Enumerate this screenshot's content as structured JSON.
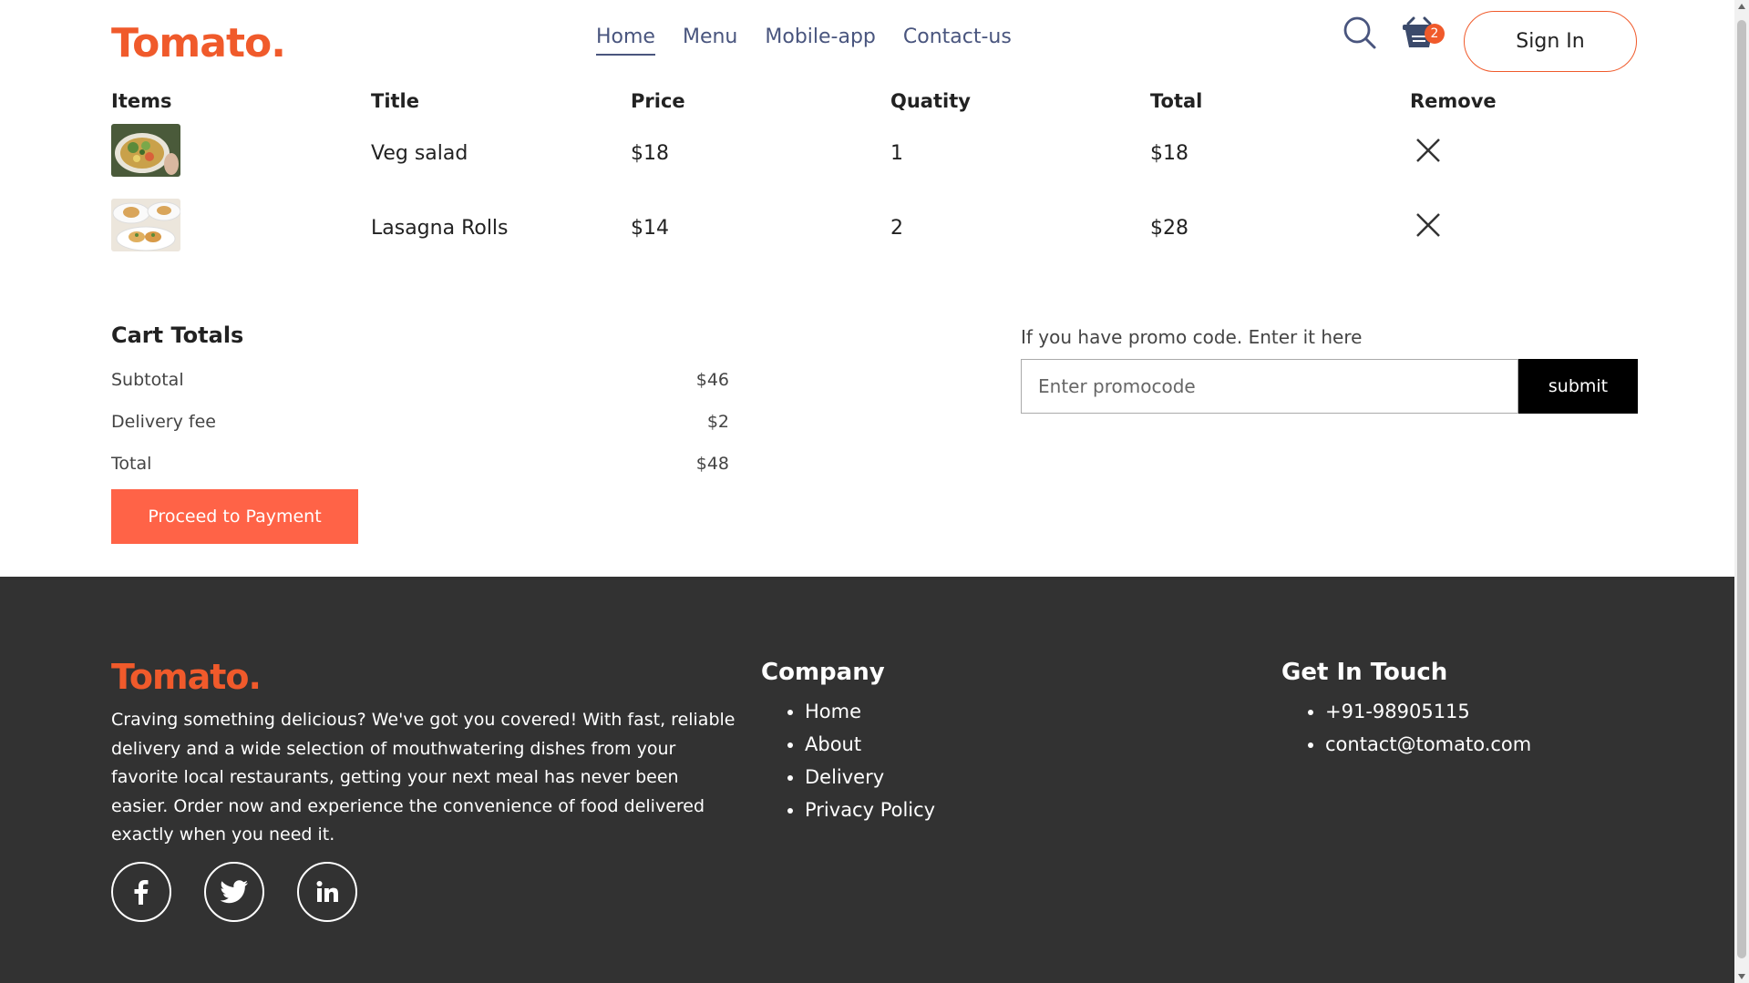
{
  "navbar": {
    "logo": "Tomato.",
    "links": [
      {
        "label": "Home",
        "active": true
      },
      {
        "label": "Menu",
        "active": false
      },
      {
        "label": "Mobile-app",
        "active": false
      },
      {
        "label": "Contact-us",
        "active": false
      }
    ],
    "search_icon": "search-icon",
    "cart_icon": "basket-icon",
    "cart_count": "2",
    "signin_label": "Sign In"
  },
  "cart": {
    "headers": [
      "Items",
      "Title",
      "Price",
      "Quatity",
      "Total",
      "Remove"
    ],
    "rows": [
      {
        "image": "veg-salad-thumbnail",
        "title": "Veg salad",
        "price": "$18",
        "quantity": "1",
        "total": "$18",
        "remove_icon": "close-icon"
      },
      {
        "image": "lasagna-rolls-thumbnail",
        "title": "Lasagna Rolls",
        "price": "$14",
        "quantity": "2",
        "total": "$28",
        "remove_icon": "close-icon"
      }
    ]
  },
  "totals": {
    "heading": "Cart Totals",
    "lines": [
      {
        "label": "Subtotal",
        "value": "$46"
      },
      {
        "label": "Delivery fee",
        "value": "$2"
      },
      {
        "label": "Total",
        "value": "$48"
      }
    ],
    "proceed_label": "Proceed to Payment"
  },
  "promo": {
    "label": "If you have promo code. Enter it here",
    "placeholder": "Enter promocode",
    "submit_label": "submit"
  },
  "footer": {
    "logo": "Tomato.",
    "description": "Craving something delicious? We've got you covered! With fast, reliable delivery and a wide selection of mouthwatering dishes from your favorite local restaurants, getting your next meal has never been easier. Order now and experience the convenience of food delivered exactly when you need it.",
    "social": [
      "facebook-icon",
      "twitter-icon",
      "linkedin-icon"
    ],
    "company": {
      "heading": "Company",
      "items": [
        "Home",
        "About",
        "Delivery",
        "Privacy Policy"
      ]
    },
    "contact": {
      "heading": "Get In Touch",
      "items": [
        "+91-98905115",
        "contact@tomato.com"
      ]
    }
  },
  "colors": {
    "brand": "#f05a2b",
    "button": "#ff6347",
    "footer_bg": "#323232",
    "nav_text": "#49557e"
  }
}
